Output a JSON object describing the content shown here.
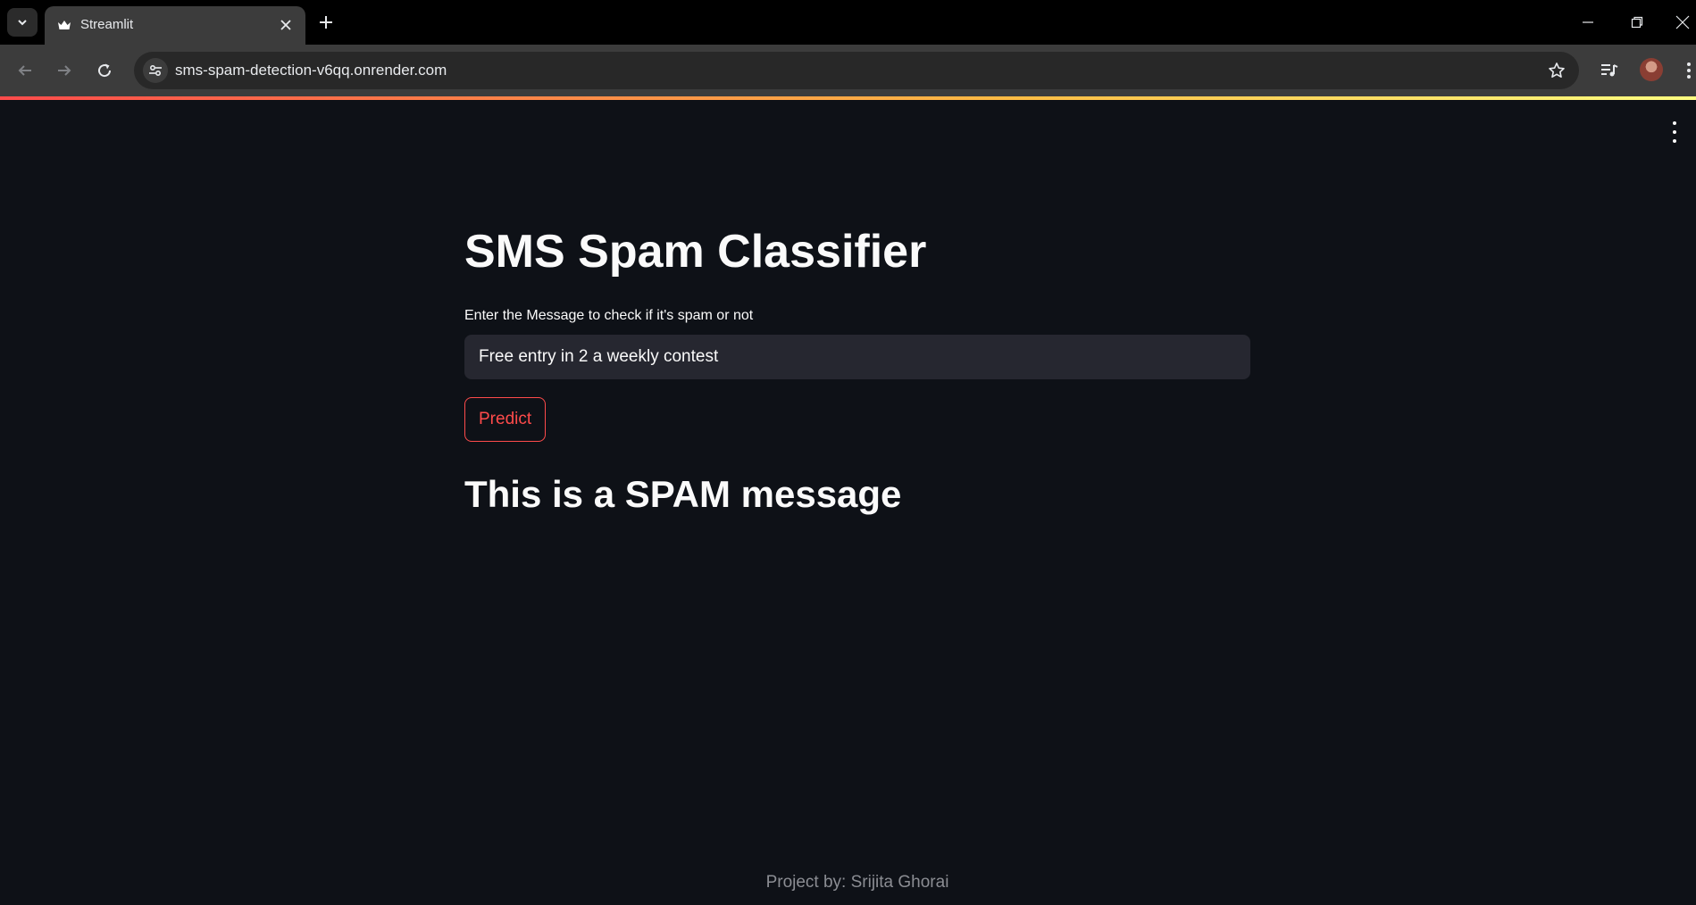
{
  "browser": {
    "tab_title": "Streamlit",
    "url": "sms-spam-detection-v6qq.onrender.com"
  },
  "app": {
    "title": "SMS Spam Classifier",
    "input_label": "Enter the Message to check if it's spam or not",
    "input_value": "Free entry in 2 a weekly contest",
    "button_label": "Predict",
    "result": "This is a SPAM message",
    "footer": "Project by: Srijita Ghorai"
  },
  "colors": {
    "background": "#0e1117",
    "accent": "#ff4b4b",
    "input_bg": "#262730",
    "text": "#fafafa"
  }
}
